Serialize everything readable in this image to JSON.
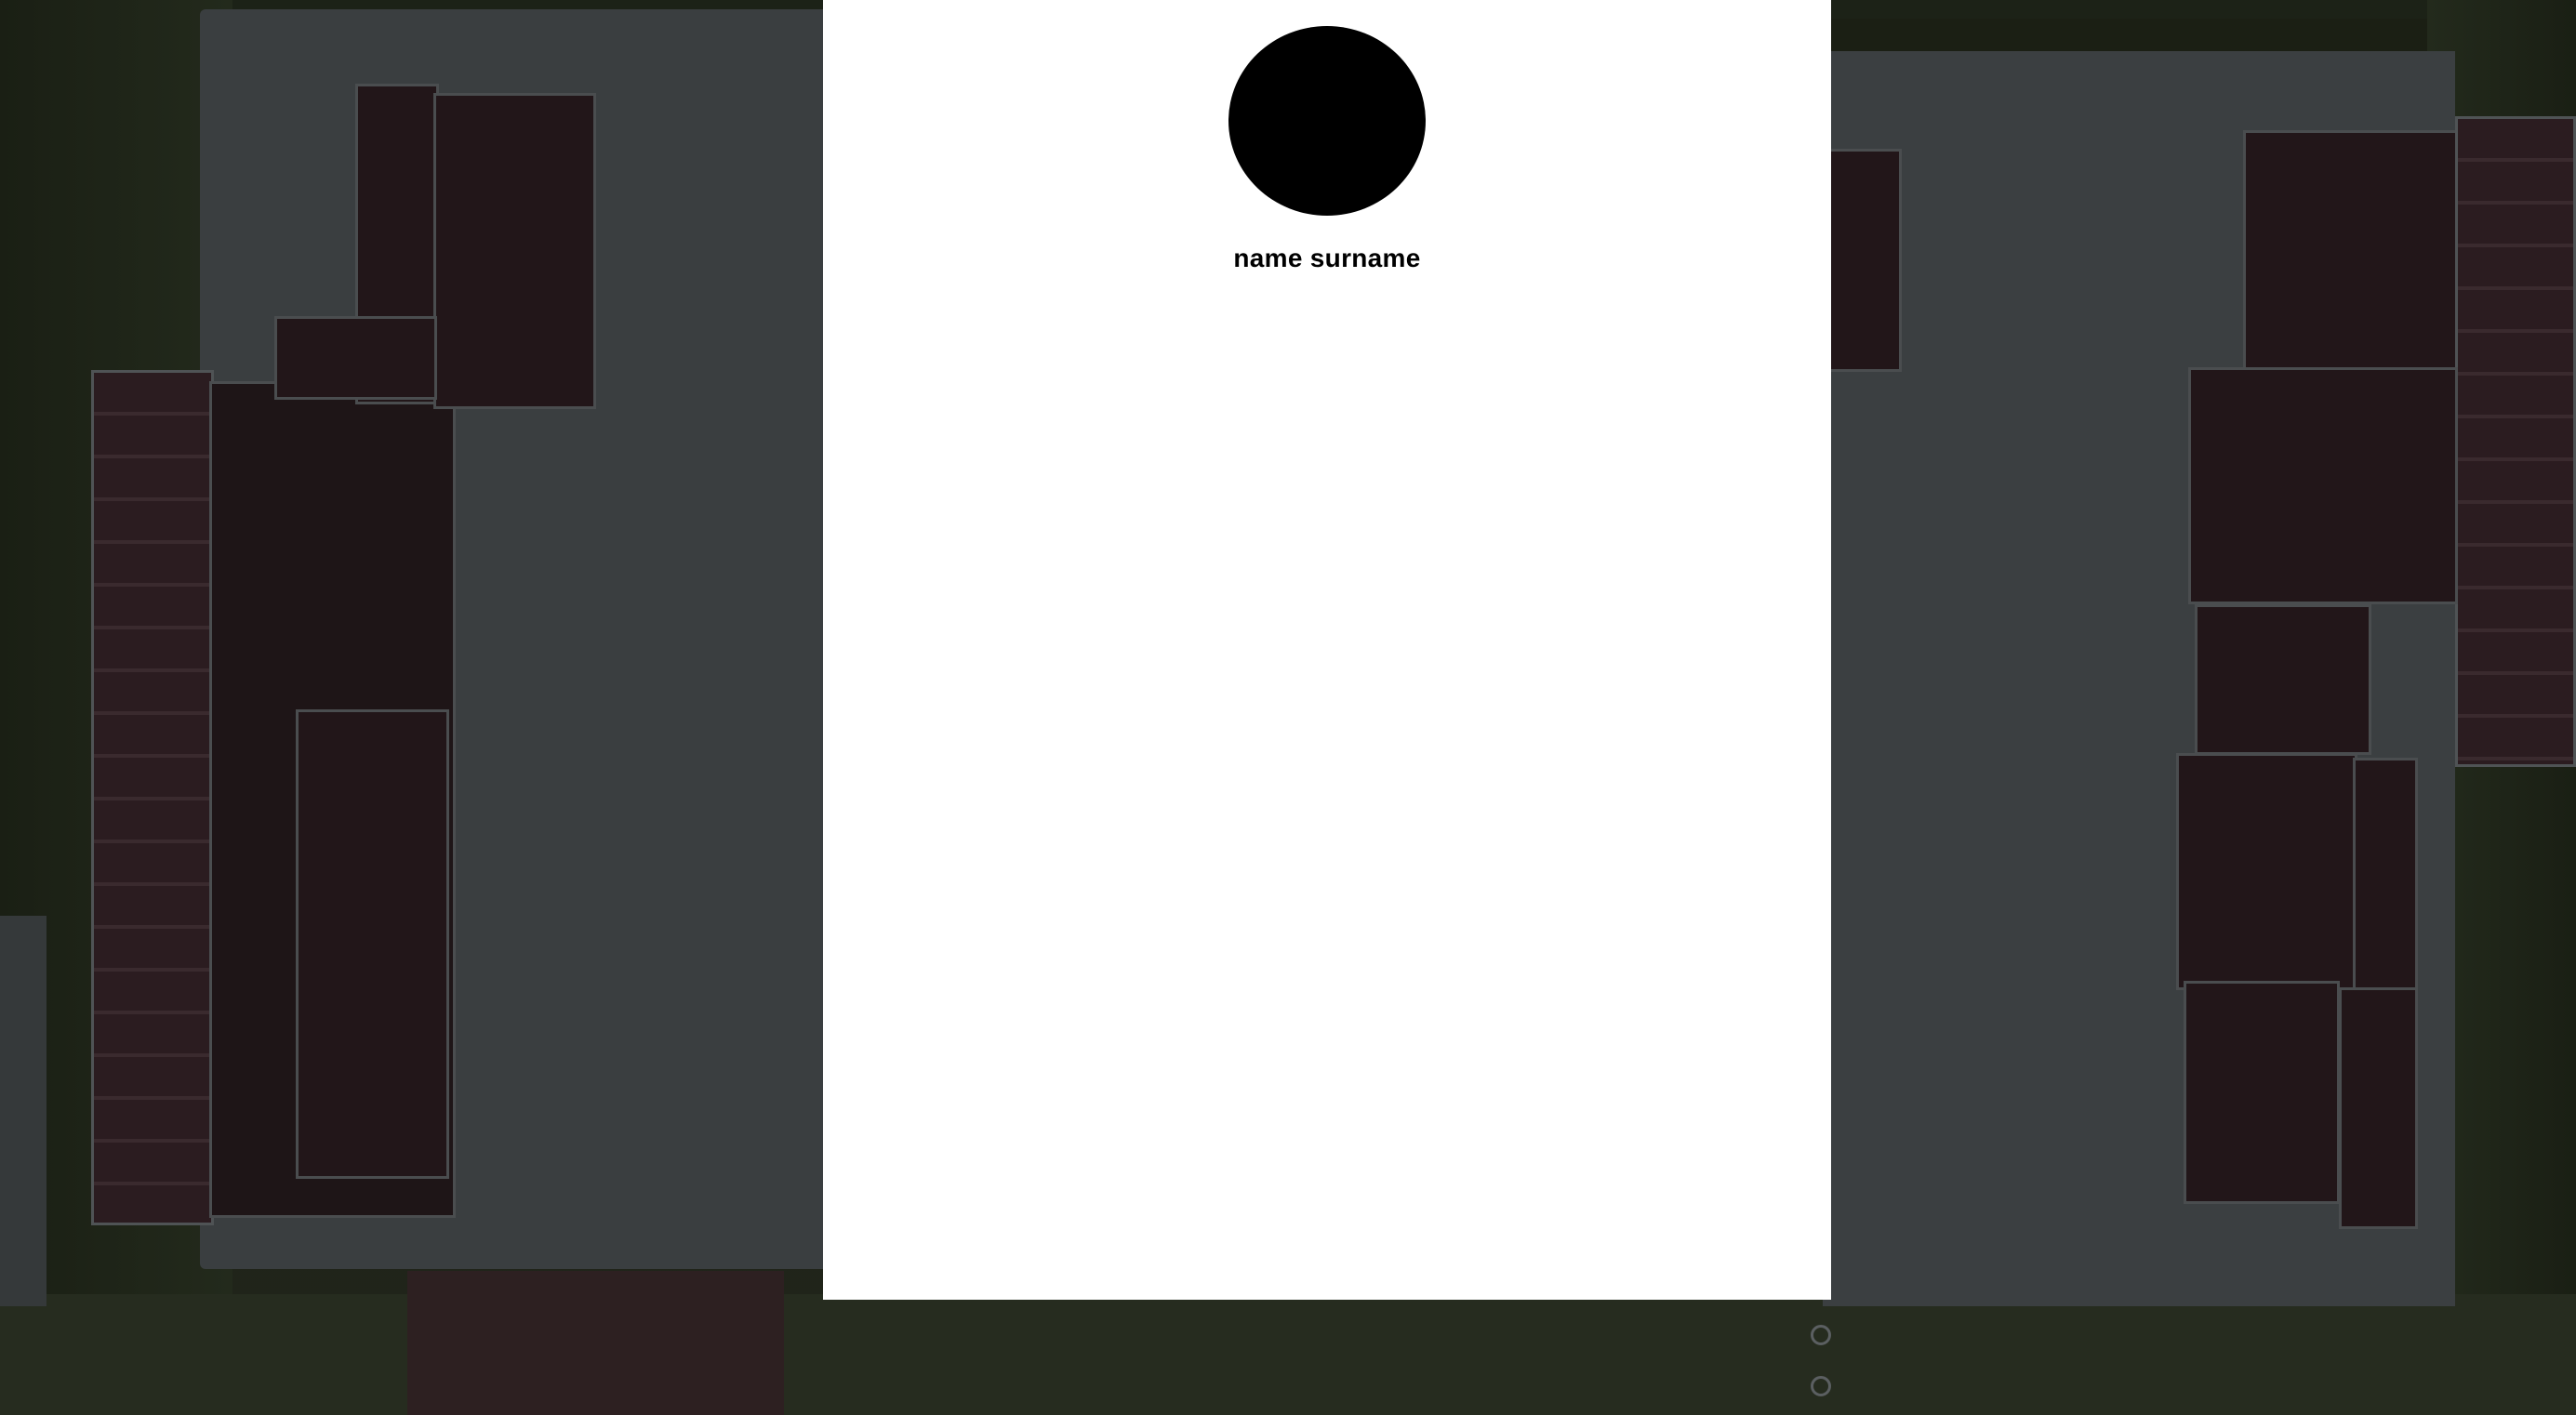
{
  "profile": {
    "name": "name surname"
  },
  "colors": {
    "panel_background": "#ffffff",
    "avatar_fill": "#000000",
    "name_text": "#000000",
    "backdrop_dim": "#2a2e30"
  },
  "icons": {
    "avatar": "avatar-placeholder-circle"
  }
}
